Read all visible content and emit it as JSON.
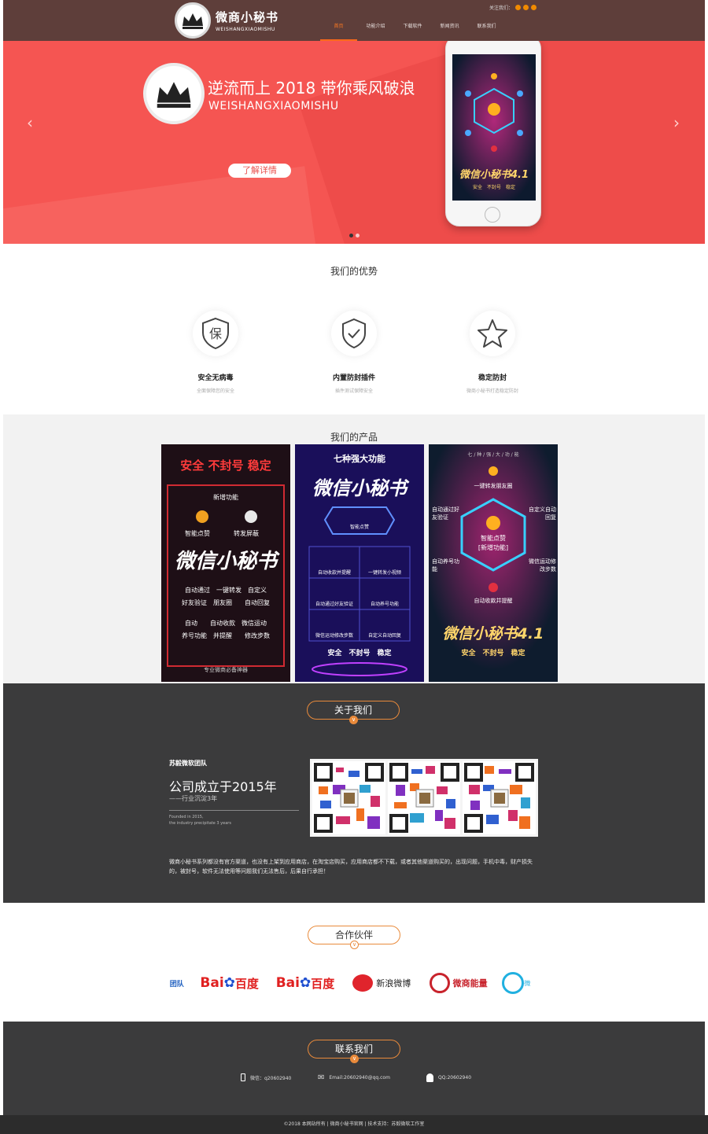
{
  "header": {
    "logo_cn": "微商小秘书",
    "logo_en": "WEISHANGXIAOMISHU",
    "follow_label": "关注我们：",
    "nav": [
      {
        "label": "首页",
        "active": true
      },
      {
        "label": "功能介绍",
        "active": false
      },
      {
        "label": "下载软件",
        "active": false
      },
      {
        "label": "新闻资讯",
        "active": false
      },
      {
        "label": "联系我们",
        "active": false
      }
    ]
  },
  "banner": {
    "title": "逆流而上 2018 带你乘风破浪",
    "subtitle": "WEISHANGXIAOMISHU",
    "button": "了解详情",
    "prev": "‹",
    "next": "›",
    "phone_brand": "微信小秘书4.1",
    "phone_tagline": "安全　不封号　稳定"
  },
  "advantages": {
    "title": "我们的优势",
    "items": [
      {
        "icon": "shield-bao-icon",
        "name": "安全无病毒",
        "desc": "全面保障您的安全"
      },
      {
        "icon": "shield-check-icon",
        "name": "内置防封插件",
        "desc": "插件测试保障安全"
      },
      {
        "icon": "star-icon",
        "name": "稳定防封",
        "desc": "微商小秘书打造稳定防封"
      }
    ]
  },
  "products": {
    "title": "我们的产品",
    "cards": [
      {
        "headline": "安全 不封号 稳定",
        "new": "新增功能",
        "feat1": "智能点赞",
        "feat2": "转发屏蔽",
        "brand": "微信小秘书",
        "rows": [
          "自动通过　一键转发　自定义",
          "好友验证　朋友圈　　自动回复",
          "自动　　自动收款　微信运动",
          "养号功能　并提醒　　修改步数"
        ],
        "footer": "专业微商必备神器"
      },
      {
        "headline": "七种强大功能",
        "brand": "微信小秘书",
        "center": "智能点赞",
        "cells": [
          "自动收款并提醒",
          "一键转发小视频",
          "自动通过好友验证",
          "自动养号功能",
          "微信运动修改步数",
          "自定义自动回复"
        ],
        "footer": "安全　不封号　稳定"
      },
      {
        "headline": "七 / 种 / 强 / 大 / 功 / 能",
        "top": "一键转发朋友圈",
        "left1": "自动通过好友验证",
        "right1": "自定义自动回复",
        "center": "智能点赞",
        "center_sub": "[新增功能]",
        "left2": "自动养号功能",
        "right2": "微信运动修改步数",
        "bottom": "自动收款并提醒",
        "brand": "微信小秘书4.1",
        "footer": "安全　不封号　稳定"
      }
    ]
  },
  "about": {
    "title": "关于我们",
    "team": "苏毅微软团队",
    "year": "公司成立于2015年",
    "sub": "——行业沉淀3年",
    "en_line1": "Founded in 2015,",
    "en_line2": "the industry precipitate 3 years",
    "desc": "微商小秘书系列都没有官方渠道，也没有上架到应用商店，在淘宝店购买，应用商店都不下载，或者其他渠道购买的，出现问题，手机中毒，财产损失的，被封号，软件无法使用等问题我们无法售后，后果自行承担！"
  },
  "partners": {
    "title": "合作伙伴",
    "items": [
      "团队",
      "百度",
      "百度",
      "新浪微博",
      "微商能量",
      "微"
    ]
  },
  "contact": {
    "title": "联系我们",
    "phone": "微信：q20602940",
    "email": "Email:20602940@qq.com",
    "qq": "QQ:20602940"
  },
  "footer": {
    "text": "©2018 本网站所有 | 微商小秘书官网 | 技术支持：苏毅微软工作室"
  },
  "colors": {
    "header_bg": "#5e3e3a",
    "banner_bg": "#f55552",
    "accent": "#ff6a1a",
    "dark_section": "#3b3b3c"
  }
}
